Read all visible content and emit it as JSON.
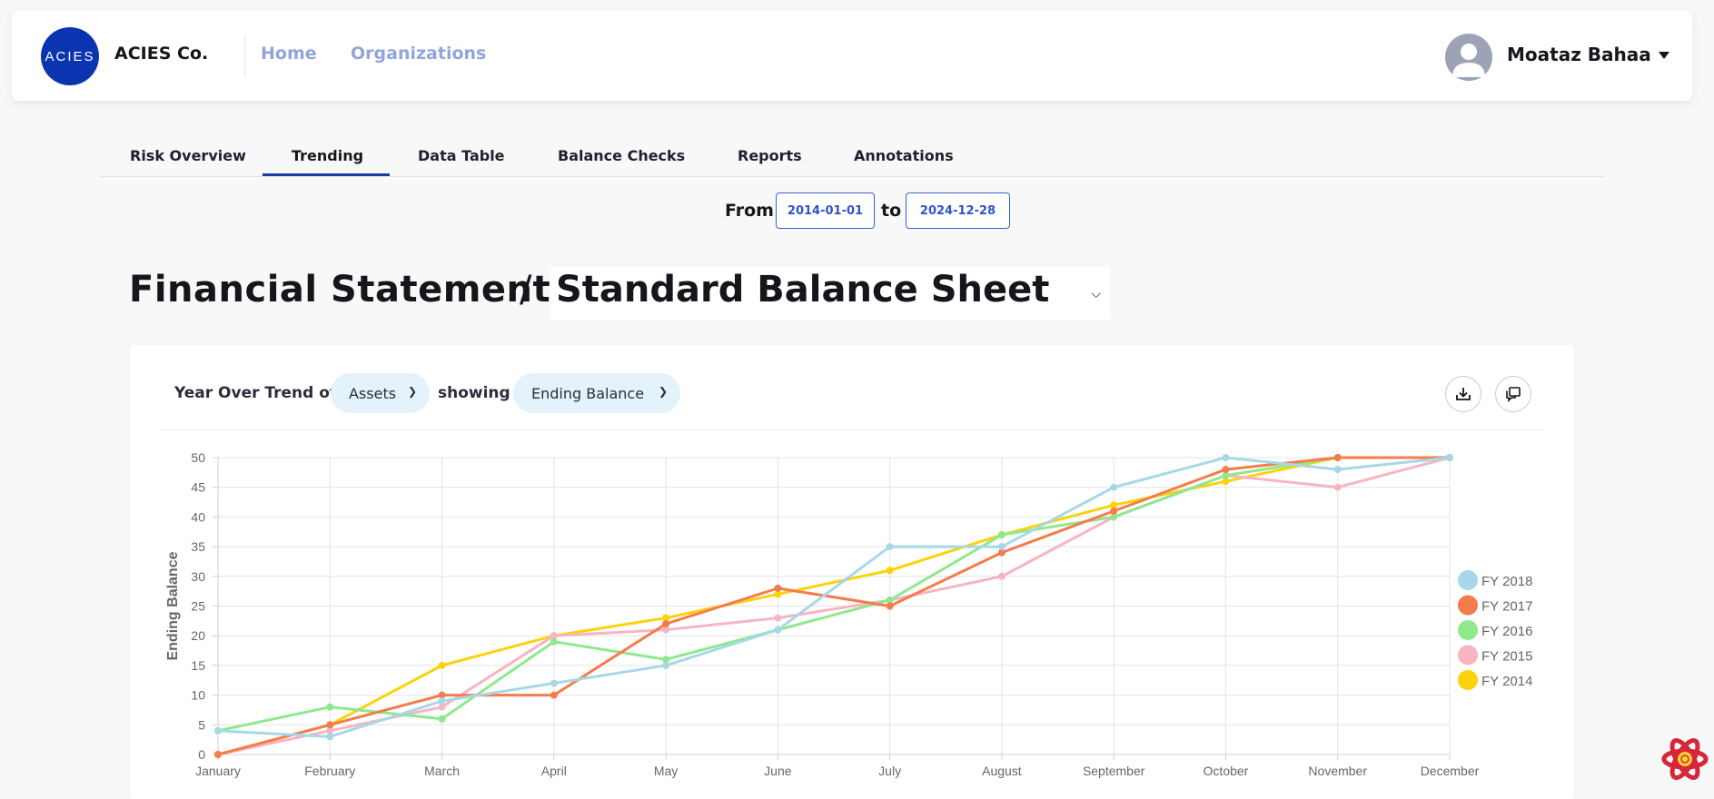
{
  "navbar": {
    "logo_text": "ACIES",
    "brand": "ACIES Co.",
    "links": [
      "Home",
      "Organizations"
    ],
    "user_name": "Moataz Bahaa"
  },
  "tabs": [
    "Risk Overview",
    "Trending",
    "Data Table",
    "Balance Checks",
    "Reports",
    "Annotations"
  ],
  "active_tab": "Trending",
  "date_range": {
    "from_label": "From",
    "from_value": "2014-01-01",
    "to_label": "to",
    "to_value": "2024-12-28"
  },
  "heading": {
    "title": "Financial Statement",
    "separator": "/",
    "statement": "Standard Balance Sheet"
  },
  "controls": {
    "trend_label": "Year Over Trend of",
    "trend_value": "Assets",
    "showing_label": "showing",
    "showing_value": "Ending Balance",
    "download_icon": "download-icon",
    "comments_icon": "comments-icon"
  },
  "chart_data": {
    "type": "line",
    "ylabel": "Ending Balance",
    "xlabel": "",
    "ylim": [
      0,
      50
    ],
    "yticks": [
      0,
      5,
      10,
      15,
      20,
      25,
      30,
      35,
      40,
      45,
      50
    ],
    "grid": true,
    "legend_position": "right",
    "categories": [
      "January",
      "February",
      "March",
      "April",
      "May",
      "June",
      "July",
      "August",
      "September",
      "October",
      "November",
      "December"
    ],
    "series": [
      {
        "name": "FY 2018",
        "color": "#a7d8e8",
        "values": [
          4,
          3,
          9,
          12,
          15,
          21,
          35,
          35,
          45,
          50,
          48,
          50
        ]
      },
      {
        "name": "FY 2017",
        "color": "#f47c4b",
        "values": [
          0,
          5,
          10,
          10,
          22,
          28,
          25,
          34,
          41,
          48,
          50,
          50
        ]
      },
      {
        "name": "FY 2016",
        "color": "#8fe88c",
        "values": [
          4,
          8,
          6,
          19,
          16,
          21,
          26,
          37,
          40,
          47,
          50,
          50
        ]
      },
      {
        "name": "FY 2015",
        "color": "#f7b4c1",
        "values": [
          0,
          4,
          8,
          20,
          21,
          23,
          26,
          30,
          40,
          47,
          45,
          50
        ]
      },
      {
        "name": "FY 2014",
        "color": "#fcd20b",
        "values": [
          0,
          5,
          15,
          20,
          23,
          27,
          31,
          37,
          42,
          46,
          50,
          50
        ]
      }
    ]
  }
}
